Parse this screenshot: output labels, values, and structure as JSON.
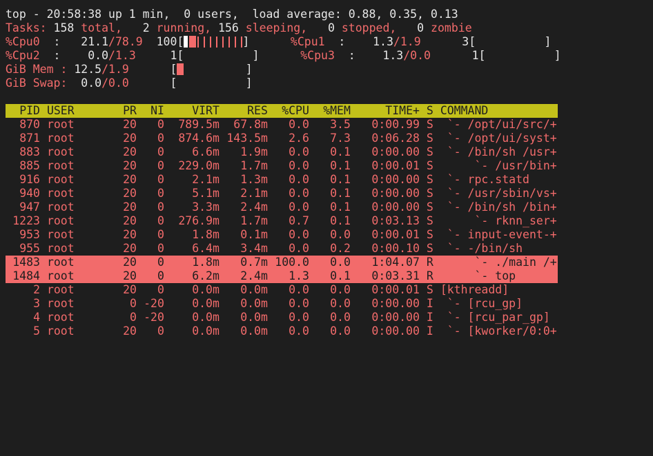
{
  "summary": {
    "uptime_line": "top - 20:58:38 up 1 min,  0 users,  load average: 0.88, 0.35, 0.13",
    "tasks_label": "Tasks:",
    "tasks_total": "158",
    "tasks_total_label": "total,",
    "tasks_running": "2",
    "tasks_running_label": "running,",
    "tasks_sleeping": "156",
    "tasks_sleeping_label": "sleeping,",
    "tasks_stopped": "0",
    "tasks_stopped_label": "stopped,",
    "tasks_zombie": "0",
    "tasks_zombie_label": "zombie"
  },
  "cpus": [
    {
      "label": "%Cpu0",
      "user": "21.1",
      "sys": "78.9",
      "pct": "100"
    },
    {
      "label": "%Cpu1",
      "user": "1.3",
      "sys": "1.9",
      "pct": "3"
    },
    {
      "label": "%Cpu2",
      "user": "0.0",
      "sys": "1.3",
      "pct": "1"
    },
    {
      "label": "%Cpu3",
      "user": "1.3",
      "sys": "0.0",
      "pct": "1"
    }
  ],
  "memory": {
    "mem_label": "GiB Mem :",
    "mem_used": "12.5",
    "mem_avail": "1.9",
    "swap_label": "GiB Swap:",
    "swap_used": "0.0",
    "swap_avail": "0.0"
  },
  "columns": [
    "PID",
    "USER",
    "PR",
    "NI",
    "VIRT",
    "RES",
    "%CPU",
    "%MEM",
    "TIME+",
    "S",
    "COMMAND"
  ],
  "processes": [
    {
      "pid": "870",
      "user": "root",
      "pr": "20",
      "ni": "0",
      "virt": "789.5m",
      "res": "67.8m",
      "cpu": "0.0",
      "mem": "3.5",
      "time": "0:00.99",
      "s": "S",
      "cmd": " `- /opt/ui/src/+",
      "hl": false
    },
    {
      "pid": "871",
      "user": "root",
      "pr": "20",
      "ni": "0",
      "virt": "874.6m",
      "res": "143.5m",
      "cpu": "2.6",
      "mem": "7.3",
      "time": "0:06.28",
      "s": "S",
      "cmd": " `- /opt/ui/syst+",
      "hl": false
    },
    {
      "pid": "883",
      "user": "root",
      "pr": "20",
      "ni": "0",
      "virt": "6.6m",
      "res": "1.9m",
      "cpu": "0.0",
      "mem": "0.1",
      "time": "0:00.00",
      "s": "S",
      "cmd": " `- /bin/sh /usr+",
      "hl": false
    },
    {
      "pid": "885",
      "user": "root",
      "pr": "20",
      "ni": "0",
      "virt": "229.0m",
      "res": "1.7m",
      "cpu": "0.0",
      "mem": "0.1",
      "time": "0:00.01",
      "s": "S",
      "cmd": "     `- /usr/bin+",
      "hl": false
    },
    {
      "pid": "916",
      "user": "root",
      "pr": "20",
      "ni": "0",
      "virt": "2.1m",
      "res": "1.3m",
      "cpu": "0.0",
      "mem": "0.1",
      "time": "0:00.00",
      "s": "S",
      "cmd": " `- rpc.statd",
      "hl": false
    },
    {
      "pid": "940",
      "user": "root",
      "pr": "20",
      "ni": "0",
      "virt": "5.1m",
      "res": "2.1m",
      "cpu": "0.0",
      "mem": "0.1",
      "time": "0:00.00",
      "s": "S",
      "cmd": " `- /usr/sbin/vs+",
      "hl": false
    },
    {
      "pid": "947",
      "user": "root",
      "pr": "20",
      "ni": "0",
      "virt": "3.3m",
      "res": "2.4m",
      "cpu": "0.0",
      "mem": "0.1",
      "time": "0:00.00",
      "s": "S",
      "cmd": " `- /bin/sh /bin+",
      "hl": false
    },
    {
      "pid": "1223",
      "user": "root",
      "pr": "20",
      "ni": "0",
      "virt": "276.9m",
      "res": "1.7m",
      "cpu": "0.7",
      "mem": "0.1",
      "time": "0:03.13",
      "s": "S",
      "cmd": "     `- rknn_ser+",
      "hl": false
    },
    {
      "pid": "953",
      "user": "root",
      "pr": "20",
      "ni": "0",
      "virt": "1.8m",
      "res": "0.1m",
      "cpu": "0.0",
      "mem": "0.0",
      "time": "0:00.01",
      "s": "S",
      "cmd": " `- input-event-+",
      "hl": false
    },
    {
      "pid": "955",
      "user": "root",
      "pr": "20",
      "ni": "0",
      "virt": "6.4m",
      "res": "3.4m",
      "cpu": "0.0",
      "mem": "0.2",
      "time": "0:00.10",
      "s": "S",
      "cmd": " `- -/bin/sh",
      "hl": false
    },
    {
      "pid": "1483",
      "user": "root",
      "pr": "20",
      "ni": "0",
      "virt": "1.8m",
      "res": "0.7m",
      "cpu": "100.0",
      "mem": "0.0",
      "time": "1:04.07",
      "s": "R",
      "cmd": "     `- ./main /+",
      "hl": true
    },
    {
      "pid": "1484",
      "user": "root",
      "pr": "20",
      "ni": "0",
      "virt": "6.2m",
      "res": "2.4m",
      "cpu": "1.3",
      "mem": "0.1",
      "time": "0:03.31",
      "s": "R",
      "cmd": "     `- top",
      "hl": true
    },
    {
      "pid": "2",
      "user": "root",
      "pr": "20",
      "ni": "0",
      "virt": "0.0m",
      "res": "0.0m",
      "cpu": "0.0",
      "mem": "0.0",
      "time": "0:00.01",
      "s": "S",
      "cmd": "[kthreadd]",
      "hl": false
    },
    {
      "pid": "3",
      "user": "root",
      "pr": "0",
      "ni": "-20",
      "virt": "0.0m",
      "res": "0.0m",
      "cpu": "0.0",
      "mem": "0.0",
      "time": "0:00.00",
      "s": "I",
      "cmd": " `- [rcu_gp]",
      "hl": false
    },
    {
      "pid": "4",
      "user": "root",
      "pr": "0",
      "ni": "-20",
      "virt": "0.0m",
      "res": "0.0m",
      "cpu": "0.0",
      "mem": "0.0",
      "time": "0:00.00",
      "s": "I",
      "cmd": " `- [rcu_par_gp]",
      "hl": false
    },
    {
      "pid": "5",
      "user": "root",
      "pr": "20",
      "ni": "0",
      "virt": "0.0m",
      "res": "0.0m",
      "cpu": "0.0",
      "mem": "0.0",
      "time": "0:00.00",
      "s": "I",
      "cmd": " `- [kworker/0:0+",
      "hl": false
    }
  ],
  "colors": {
    "background": "#1e1e1e",
    "foreground": "#e6e6e6",
    "accent_red": "#f26b6b",
    "header_bar": "#c3c11a"
  }
}
